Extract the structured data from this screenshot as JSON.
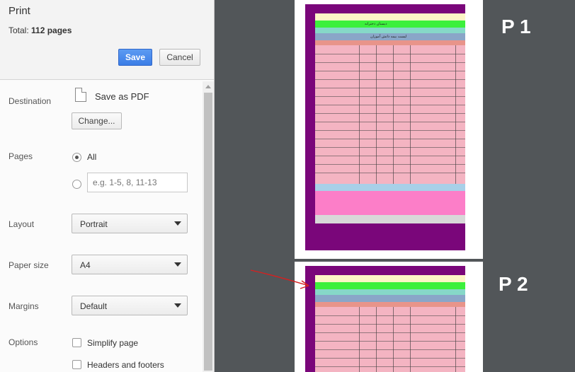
{
  "header": {
    "title": "Print",
    "total_label": "Total:",
    "total_value": "112 pages",
    "save_label": "Save",
    "cancel_label": "Cancel"
  },
  "destination": {
    "label": "Destination",
    "value": "Save as PDF",
    "change_label": "Change...",
    "icon": "document-icon"
  },
  "pages": {
    "label": "Pages",
    "all_label": "All",
    "all_selected": true,
    "custom_placeholder": "e.g. 1-5, 8, 11-13"
  },
  "layout": {
    "label": "Layout",
    "value": "Portrait"
  },
  "paper_size": {
    "label": "Paper size",
    "value": "A4"
  },
  "margins": {
    "label": "Margins",
    "value": "Default"
  },
  "options": {
    "label": "Options",
    "items": [
      {
        "label": "Simplify page",
        "checked": false
      },
      {
        "label": "Headers and footers",
        "checked": false
      }
    ]
  },
  "preview": {
    "page_labels": [
      "P 1",
      "P 2"
    ],
    "page1_title": "دبستان دخترانه",
    "page1_subtitle": "لیست بیمه دانش آموزان",
    "colors": {
      "frame": "#7a067a",
      "green": "#3cf03c",
      "pink": "#f4b4c2",
      "arrow": "#d62020"
    }
  }
}
